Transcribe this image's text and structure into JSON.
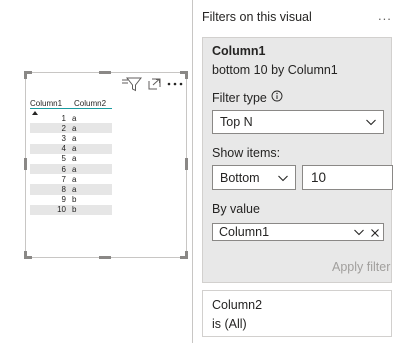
{
  "visual": {
    "columns": [
      "Column1",
      "Column2"
    ],
    "rows": [
      {
        "n": "1",
        "v": "a"
      },
      {
        "n": "2",
        "v": "a"
      },
      {
        "n": "3",
        "v": "a"
      },
      {
        "n": "4",
        "v": "a"
      },
      {
        "n": "5",
        "v": "a"
      },
      {
        "n": "6",
        "v": "a"
      },
      {
        "n": "7",
        "v": "a"
      },
      {
        "n": "8",
        "v": "a"
      },
      {
        "n": "9",
        "v": "b"
      },
      {
        "n": "10",
        "v": "b"
      }
    ]
  },
  "pane": {
    "title": "Filters on this visual",
    "more_label": "...",
    "filter_card": {
      "field": "Column1",
      "summary": "bottom 10 by Column1",
      "filter_type_label": "Filter type",
      "filter_type_value": "Top N",
      "show_items_label": "Show items:",
      "show_items_direction": "Bottom",
      "show_items_count": "10",
      "by_value_label": "By value",
      "by_value_field": "Column1",
      "apply_label": "Apply filter"
    },
    "second_card": {
      "field": "Column2",
      "summary": "is (All)"
    }
  },
  "colors": {
    "accent_teal": "#1a9ba0",
    "card_bg": "#e8e8e8",
    "disabled_text": "#a19f9d"
  },
  "icons": [
    "filter-icon",
    "focus-mode-icon",
    "more-options-icon",
    "info-icon",
    "chevron-down-icon",
    "clear-icon"
  ]
}
